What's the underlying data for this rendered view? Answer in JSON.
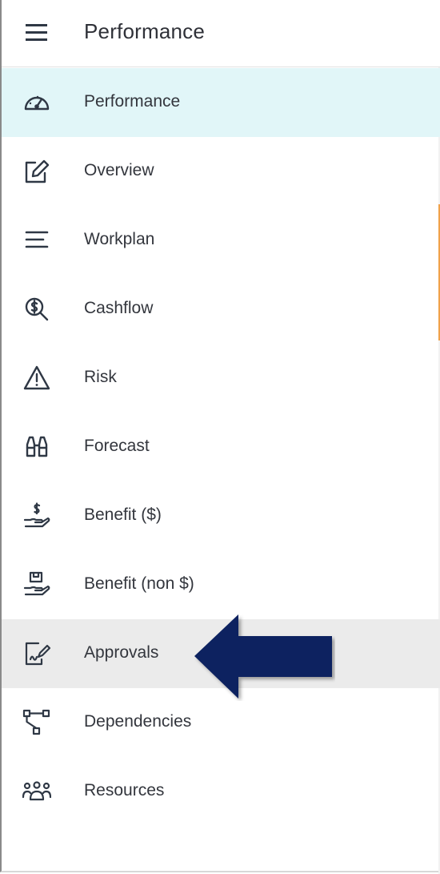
{
  "header": {
    "title": "Performance",
    "menu_icon": "hamburger-menu-icon"
  },
  "nav": {
    "items": [
      {
        "label": "Performance",
        "icon": "speedometer-icon",
        "state": "active"
      },
      {
        "label": "Overview",
        "icon": "edit-icon",
        "state": "normal"
      },
      {
        "label": "Workplan",
        "icon": "lines-icon",
        "state": "normal"
      },
      {
        "label": "Cashflow",
        "icon": "dollar-search-icon",
        "state": "normal"
      },
      {
        "label": "Risk",
        "icon": "warning-icon",
        "state": "normal"
      },
      {
        "label": "Forecast",
        "icon": "binoculars-icon",
        "state": "normal"
      },
      {
        "label": "Benefit ($)",
        "icon": "hand-dollar-icon",
        "state": "normal"
      },
      {
        "label": "Benefit (non $)",
        "icon": "hand-box-icon",
        "state": "normal"
      },
      {
        "label": "Approvals",
        "icon": "document-signature-icon",
        "state": "hover"
      },
      {
        "label": "Dependencies",
        "icon": "hierarchy-icon",
        "state": "normal"
      },
      {
        "label": "Resources",
        "icon": "people-group-icon",
        "state": "normal"
      }
    ]
  },
  "annotation": {
    "arrow_icon": "pointer-arrow-icon",
    "arrow_color": "#0d2460",
    "points_to": "Approvals"
  },
  "colors": {
    "active_bg": "#e1f6f8",
    "hover_bg": "#ebebeb",
    "text": "#33363d",
    "icon": "#2f3845"
  }
}
